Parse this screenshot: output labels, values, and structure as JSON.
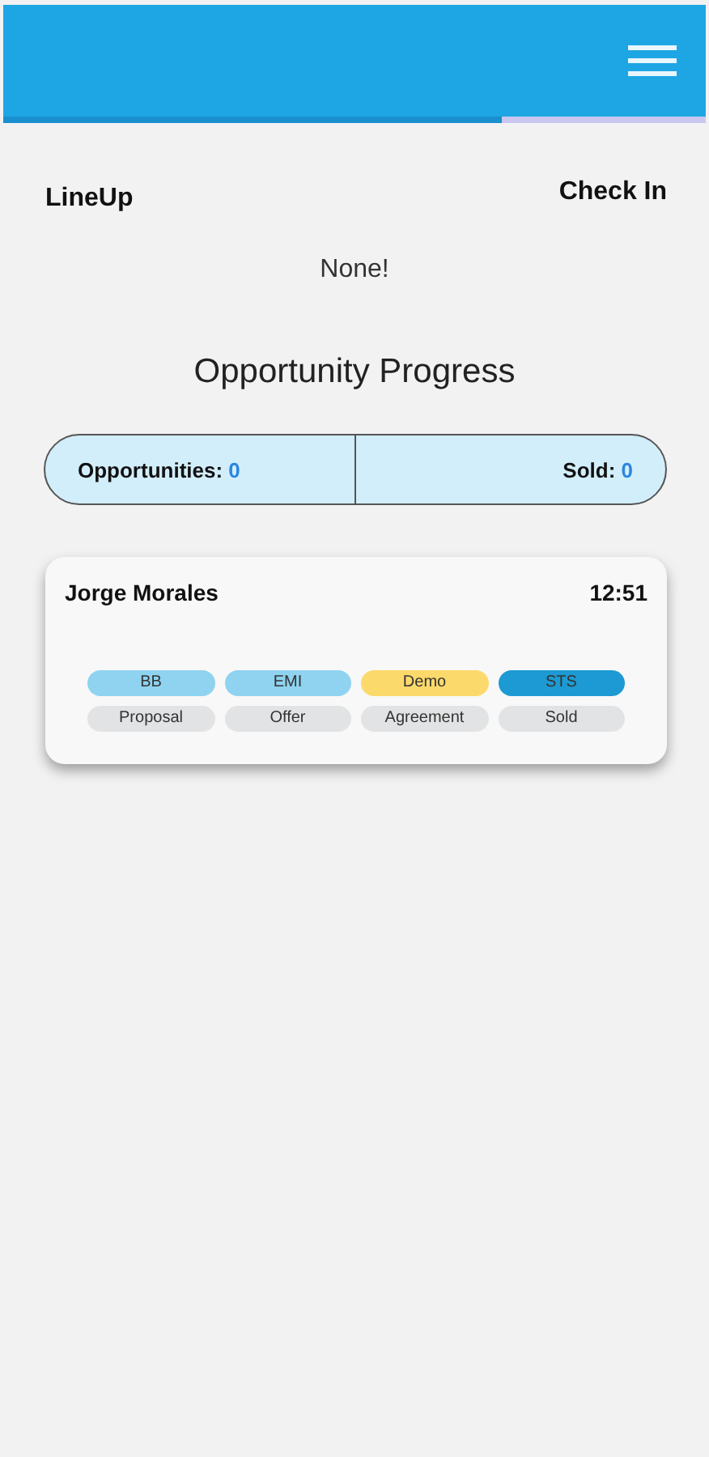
{
  "header": {
    "progress": {
      "level": 0.71
    }
  },
  "nav": {
    "left": "LineUp",
    "right": "Check In"
  },
  "empty_message": "None!",
  "section_title": "Opportunity Progress",
  "summary": {
    "left_label": "Opportunities:",
    "left_value": "0",
    "right_label": "Sold:",
    "right_value": "0"
  },
  "cards": [
    {
      "name": "Jorge Morales",
      "time": "12:51",
      "stages": [
        {
          "label": "BB",
          "color": "#8fd3f0"
        },
        {
          "label": "EMI",
          "color": "#8fd3f0"
        },
        {
          "label": "Demo",
          "color": "#fcd96b"
        },
        {
          "label": "STS",
          "color": "#1d9ad3"
        }
      ],
      "steps": [
        {
          "label": "Proposal",
          "color": "#e2e3e4"
        },
        {
          "label": "Offer",
          "color": "#e2e3e4"
        },
        {
          "label": "Agreement",
          "color": "#e2e3e4"
        },
        {
          "label": "Sold",
          "color": "#e2e3e4"
        }
      ]
    }
  ]
}
